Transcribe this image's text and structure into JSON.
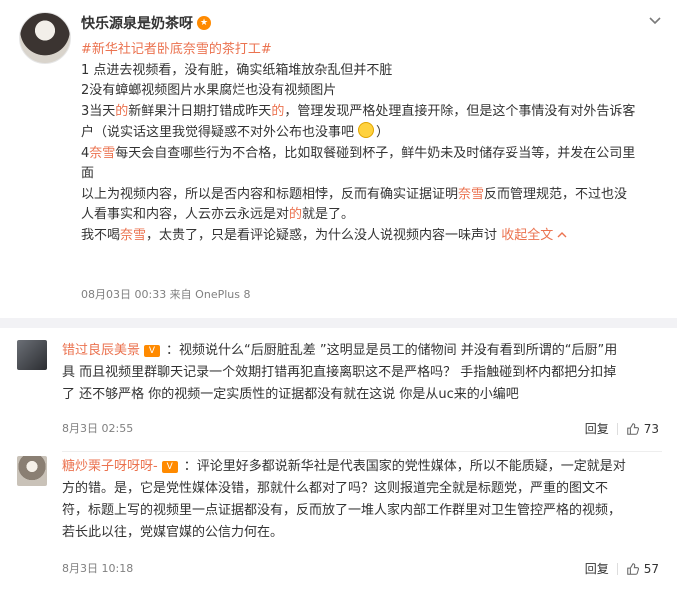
{
  "post": {
    "username": "快乐源泉是奶茶呀",
    "crown_badge": "★",
    "line1": "#新华社记者卧底奈雪的茶打工#",
    "lines": [
      "1 点进去视频看，没有脏，确实纸箱堆放杂乱但并不脏",
      "2没有蟑螂视频图片水果腐烂也没有视频图片"
    ],
    "line3_a": "3当天",
    "line3_b": "的",
    "line3_c": "新鲜果汁日期打错成昨天",
    "line3_d": "的",
    "line3_e": "，管理发现严格处理直接开除，但是这个事情没有对外告诉客",
    "line4_a": "户（说实话这里我觉得疑惑不对外公布也没事吧",
    "line4_b": "）",
    "line5_a": "4",
    "line5_b": "奈雪",
    "line5_c": "每天会自查哪些行为不合格，比如取餐碰到杯子，鲜牛奶未及时储存妥当等，并发在公司里",
    "line6": "面",
    "line7_a": "以上为视频内容，所以是否内容和标题相悖，反而有确实证据证明",
    "line7_b": "奈雪",
    "line7_c": "反而管理规范，不过也没",
    "line8_a": "人看事实和内容，人云亦云永远是对",
    "line8_b": "的",
    "line8_c": "就是了。",
    "line9_a": "我不喝",
    "line9_b": "奈雪",
    "line9_c": "，太贵了，只是看评论疑惑，为什么没人说视频内容一味声讨",
    "collapse": "收起全文",
    "meta": "08月03日 00:33  来自 OnePlus 8"
  },
  "comments": [
    {
      "name": "错过良辰美景",
      "vip": "V",
      "text_lines": [
        "：视频说什么“后厨脏乱差 ”这明显是员工的储物间 并没有看到所谓的“后厨”用",
        "具 而且视频里群聊天记录一个效期打错再犯直接离职这不是严格吗？ 手指触碰到杯内都把分扣掉",
        "了 还不够严格 你的视频一定实质性的证据都没有就在这说 你是从uc来的小编吧"
      ],
      "time": "8月3日 02:55",
      "reply": "回复",
      "likes": "73"
    },
    {
      "name": "糖炒栗子呀呀呀-",
      "vip": "V",
      "text_lines": [
        "：评论里好多都说新华社是代表国家的党性媒体，所以不能质疑，一定就是对",
        "方的错。是，它是党性媒体没错，那就什么都对了吗？这则报道完全就是标题党，严重的图文不",
        "符，标题上写的视频里一点证据都没有，反而放了一堆人家内部工作群里对卫生管控严格的视频，",
        "若长此以往，党媒官媒的公信力何在。"
      ],
      "time": "8月3日 10:18",
      "reply": "回复",
      "likes": "57"
    }
  ]
}
